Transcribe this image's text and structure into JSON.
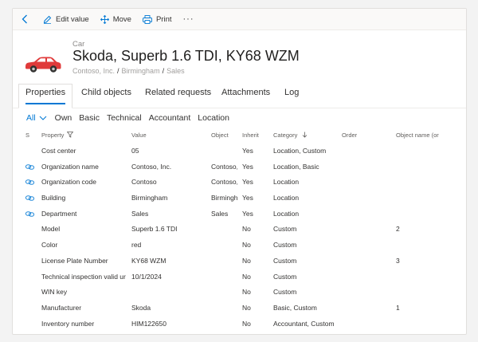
{
  "toolbar": {
    "edit_label": "Edit value",
    "move_label": "Move",
    "print_label": "Print",
    "more_label": "···"
  },
  "header": {
    "type": "Car",
    "title": "Skoda, Superb 1.6 TDI, KY68 WZM",
    "breadcrumb": [
      "Contoso, Inc.",
      "Birmingham",
      "Sales"
    ]
  },
  "tabs": [
    {
      "label": "Properties",
      "active": true
    },
    {
      "label": "Child objects"
    },
    {
      "label": "Related requests"
    },
    {
      "label": "Attachments"
    },
    {
      "label": "Log"
    }
  ],
  "filters": [
    "All",
    "Own",
    "Basic",
    "Technical",
    "Accountant",
    "Location"
  ],
  "table": {
    "headers": {
      "s": "S",
      "property": "Property",
      "value": "Value",
      "object": "Object",
      "inherit": "Inherit",
      "category": "Category",
      "order": "Order",
      "object_name": "Object name (or"
    },
    "rows": [
      {
        "linked": false,
        "property": "Cost center",
        "value": "05",
        "object": "",
        "inherit": "Yes",
        "category": "Location, Custom",
        "order": "",
        "object_name": ""
      },
      {
        "linked": true,
        "property": "Organization name",
        "value": "Contoso, Inc.",
        "object": "Contoso,",
        "inherit": "Yes",
        "category": "Location, Basic",
        "order": "",
        "object_name": ""
      },
      {
        "linked": true,
        "property": "Organization code",
        "value": "Contoso",
        "object": "Contoso,",
        "inherit": "Yes",
        "category": "Location",
        "order": "",
        "object_name": ""
      },
      {
        "linked": true,
        "property": "Building",
        "value": "Birmingham",
        "object": "Birmingh",
        "inherit": "Yes",
        "category": "Location",
        "order": "",
        "object_name": ""
      },
      {
        "linked": true,
        "property": "Department",
        "value": "Sales",
        "object": "Sales",
        "inherit": "Yes",
        "category": "Location",
        "order": "",
        "object_name": ""
      },
      {
        "linked": false,
        "property": "Model",
        "value": "Superb 1.6 TDI",
        "object": "",
        "inherit": "No",
        "category": "Custom",
        "order": "",
        "object_name": "2"
      },
      {
        "linked": false,
        "property": "Color",
        "value": "red",
        "object": "",
        "inherit": "No",
        "category": "Custom",
        "order": "",
        "object_name": ""
      },
      {
        "linked": false,
        "property": "License Plate Number",
        "value": "KY68 WZM",
        "object": "",
        "inherit": "No",
        "category": "Custom",
        "order": "",
        "object_name": "3"
      },
      {
        "linked": false,
        "property": "Technical inspection valid ur",
        "value": "10/1/2024",
        "object": "",
        "inherit": "No",
        "category": "Custom",
        "order": "",
        "object_name": ""
      },
      {
        "linked": false,
        "property": "WIN key",
        "value": "",
        "object": "",
        "inherit": "No",
        "category": "Custom",
        "order": "",
        "object_name": ""
      },
      {
        "linked": false,
        "property": "Manufacturer",
        "value": "Skoda",
        "object": "",
        "inherit": "No",
        "category": "Basic, Custom",
        "order": "",
        "object_name": "1"
      },
      {
        "linked": false,
        "property": "Inventory number",
        "value": "HIM122650",
        "object": "",
        "inherit": "No",
        "category": "Accountant, Custom",
        "order": "",
        "object_name": ""
      }
    ]
  },
  "colors": {
    "accent": "#0078d4",
    "car": "#e03a3a",
    "link_icon": "#0078d4"
  }
}
